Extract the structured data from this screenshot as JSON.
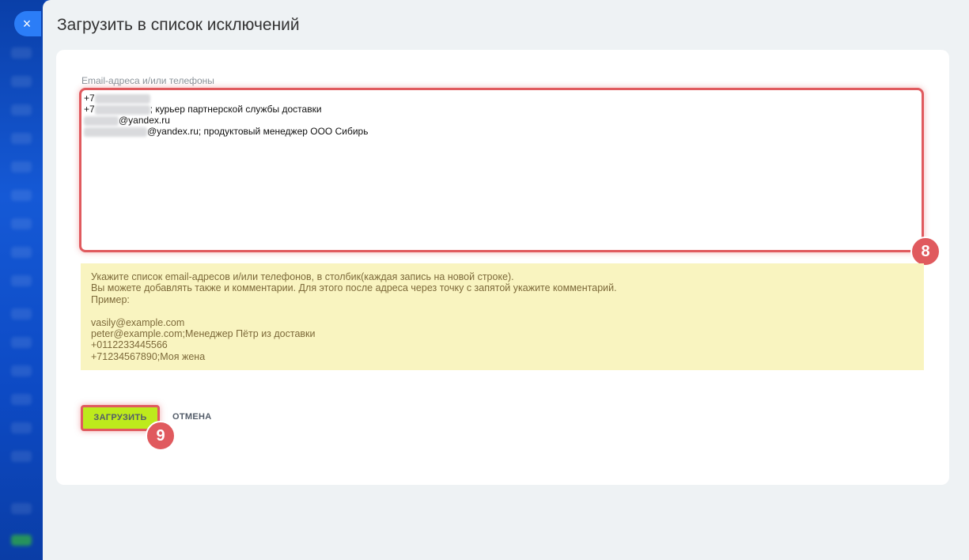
{
  "close_icon": "×",
  "title": "Загрузить в список исключений",
  "field": {
    "label": "Email-адреса и/или телефоны",
    "lines": [
      {
        "prefix": "+7",
        "suffix": ""
      },
      {
        "prefix": "+7",
        "suffix": "; курьер партнерской службы доставки"
      },
      {
        "prefix": "",
        "suffix": "@yandex.ru"
      },
      {
        "prefix": "",
        "suffix": "@yandex.ru; продуктовый менеджер ООО Сибирь"
      }
    ]
  },
  "badges": {
    "textarea": "8",
    "upload": "9"
  },
  "hint": {
    "lines": [
      "Укажите список email-адресов и/или телефонов, в столбик(каждая запись на новой строке).",
      "Вы можете добавлять также и комментарии. Для этого после адреса через точку с запятой укажите комментарий.",
      "Пример:",
      "",
      "vasily@example.com",
      "peter@example.com;Менеджер Пётр из доставки",
      "+0112233445566",
      "+71234567890;Моя жена"
    ]
  },
  "buttons": {
    "upload": "ЗАГРУЗИТЬ",
    "cancel": "ОТМЕНА"
  },
  "colors": {
    "highlight": "#e05a5e",
    "upload_button": "#bdea1c",
    "hint_bg": "#f9f4c0"
  }
}
